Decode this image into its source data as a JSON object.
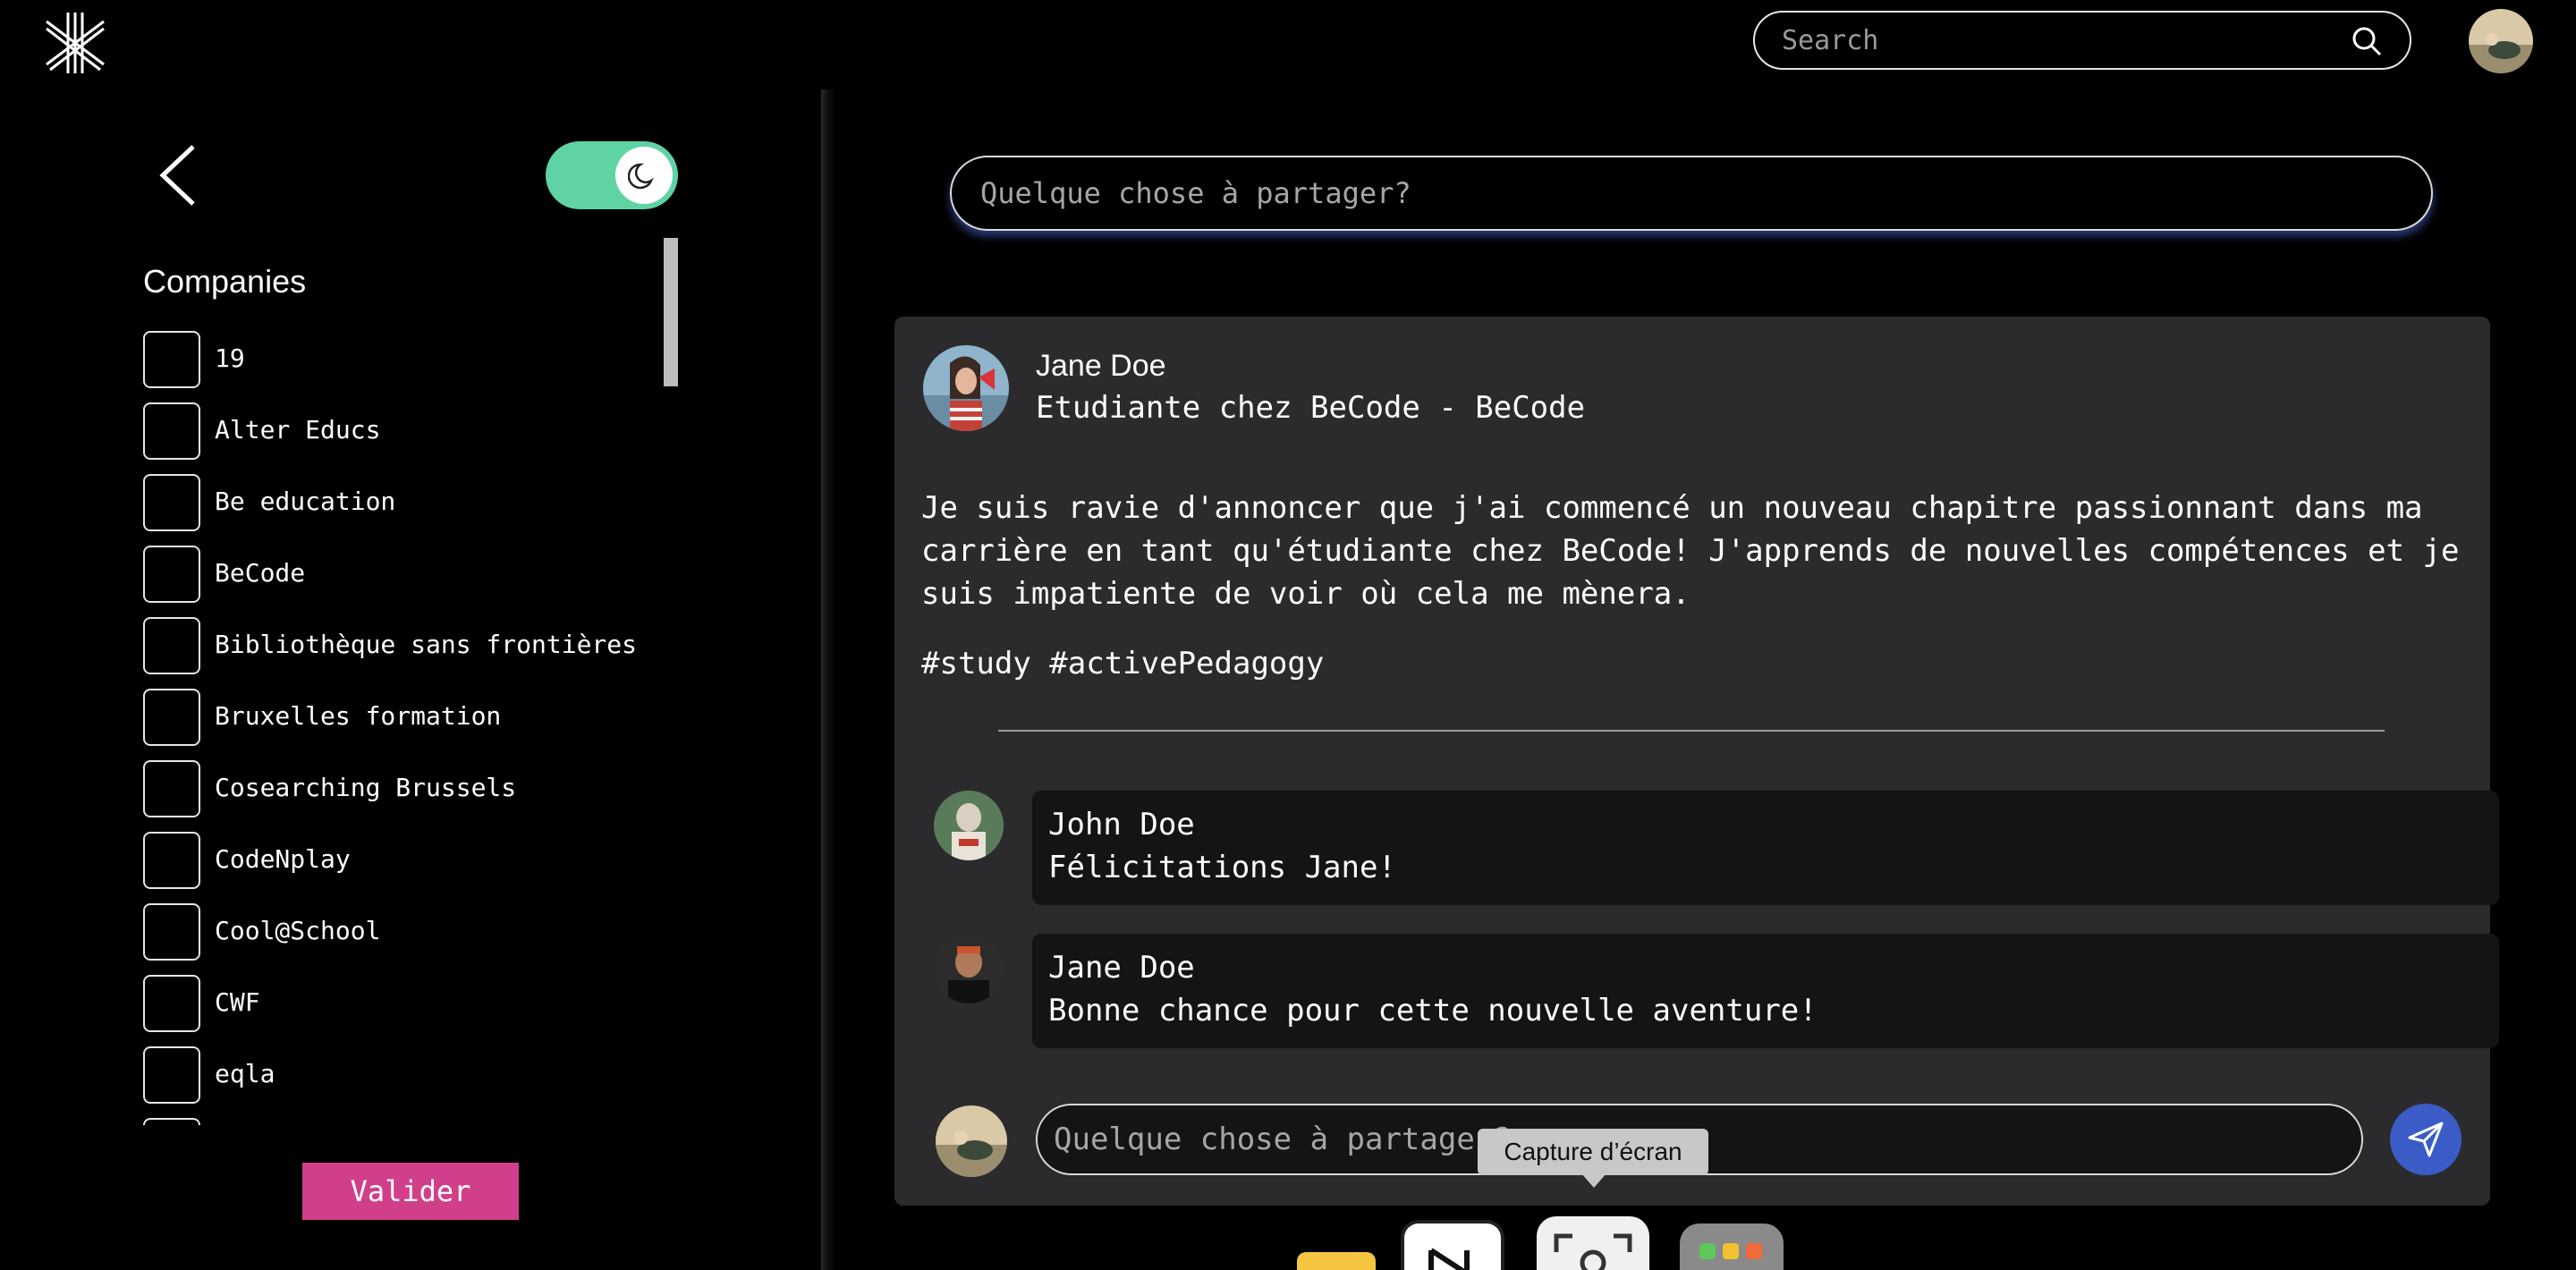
{
  "header": {
    "search_placeholder": "Search"
  },
  "sidebar": {
    "title": "Companies",
    "companies": [
      "19",
      "Alter Educs",
      "Be education",
      "BeCode",
      "Bibliothèque sans frontières",
      "Bruxelles formation",
      "Cosearching Brussels",
      "CodeNplay",
      "Cool@School",
      "CWF",
      "eqla"
    ],
    "validate_label": "Valider"
  },
  "composer": {
    "placeholder": "Quelque chose à partager?"
  },
  "post": {
    "author": "Jane Doe",
    "role": "Etudiante chez BeCode - BeCode",
    "body": "Je suis ravie d'annoncer que j'ai commencé un nouveau chapitre passionnant dans ma carrière en tant qu'étudiante chez BeCode! J'apprends de nouvelles compétences et je suis impatiente de voir où cela me mènera.",
    "tags": "#study #activePedagogy",
    "comments": [
      {
        "name": "John Doe",
        "text": "Félicitations Jane!"
      },
      {
        "name": "Jane Doe",
        "text": "Bonne chance pour cette nouvelle aventure!"
      }
    ],
    "reply_placeholder": "Quelque chose à partager?"
  },
  "tooltip": {
    "text": "Capture d’écran"
  },
  "colors": {
    "toggle": "#5fd3a3",
    "validate": "#d13f8a",
    "send": "#3b5cc6",
    "card": "#2b2b2d"
  }
}
